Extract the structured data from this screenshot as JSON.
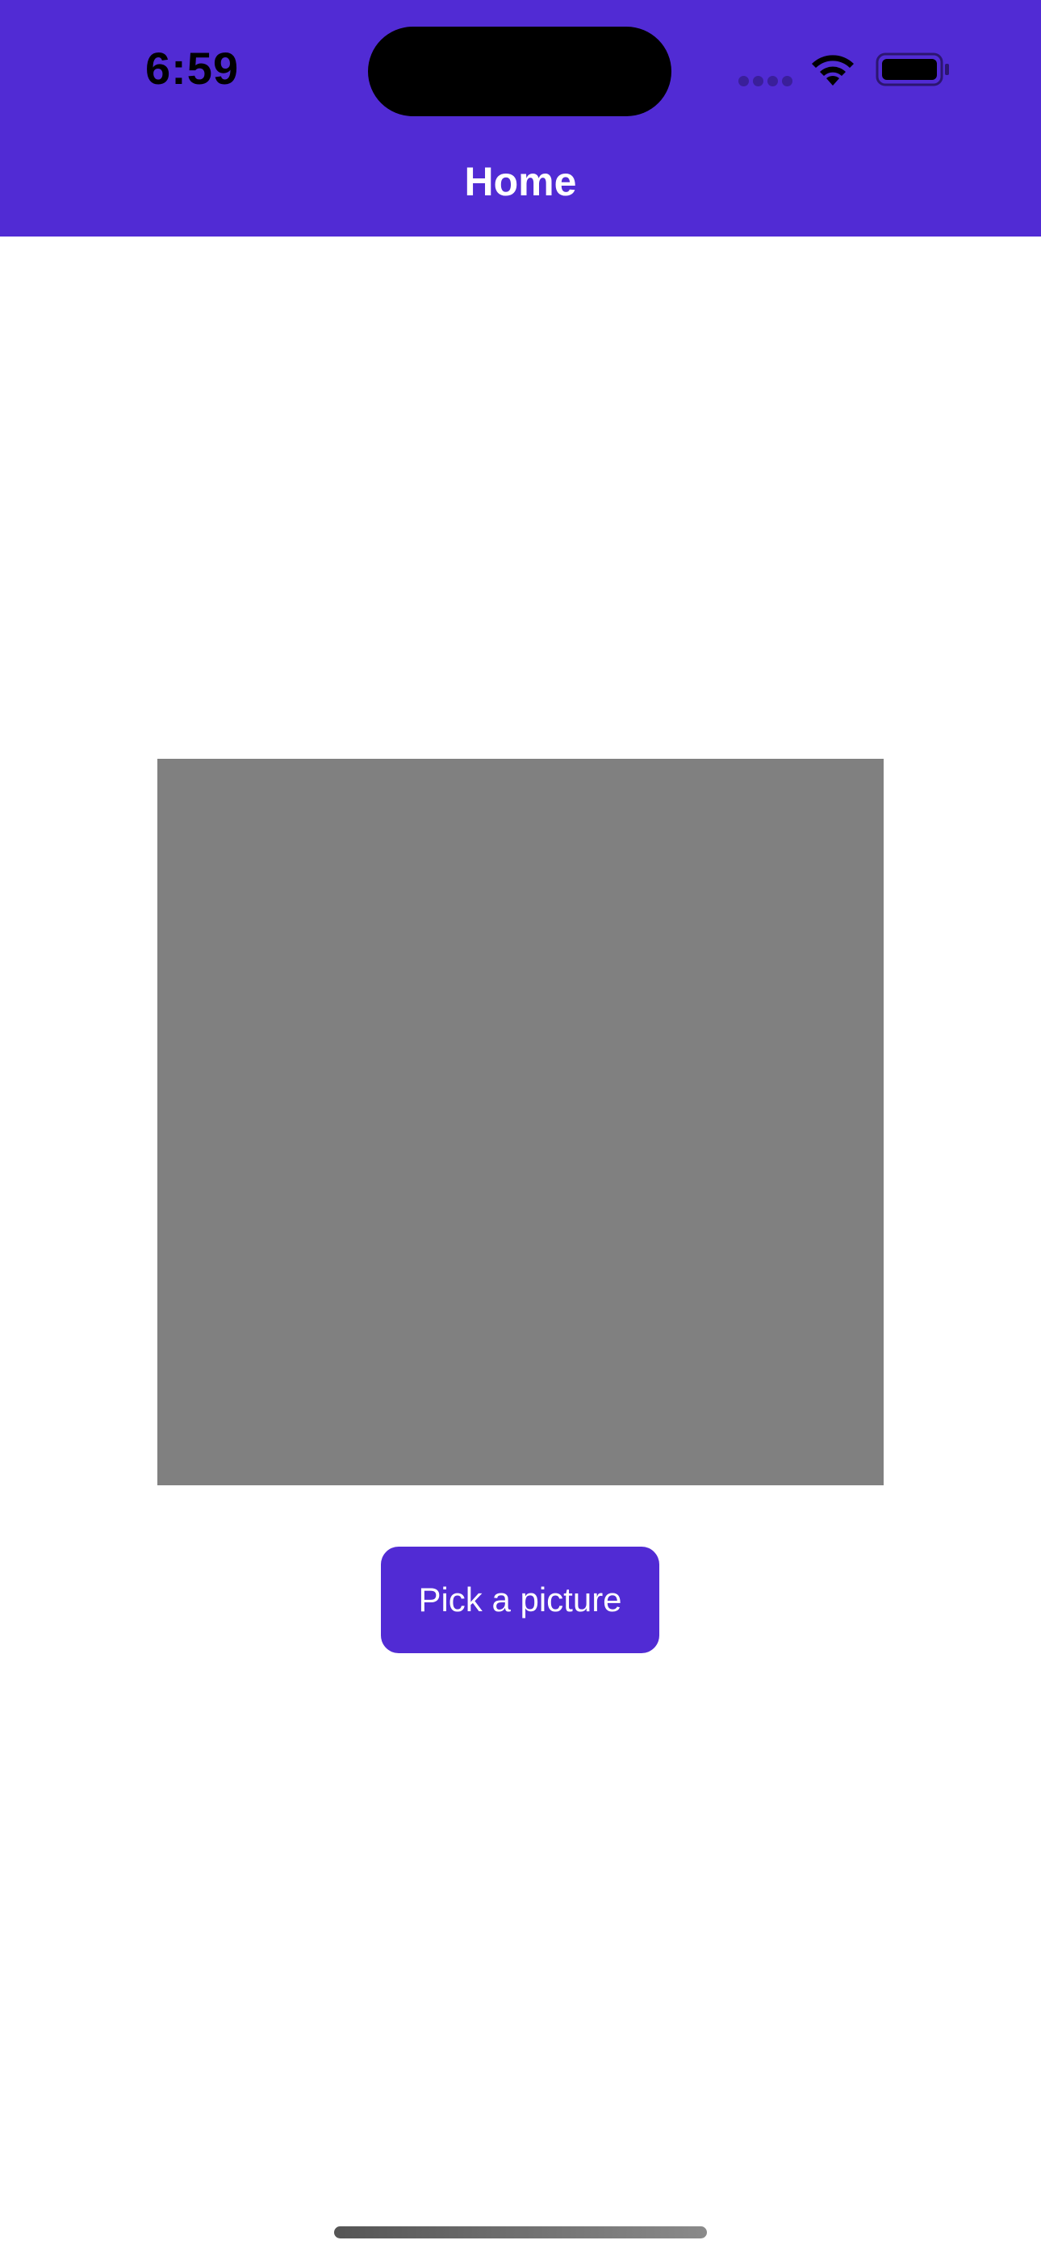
{
  "status_bar": {
    "time": "6:59",
    "icons": [
      "cellular-signal-icon",
      "wifi-icon",
      "battery-icon"
    ]
  },
  "header": {
    "title": "Home"
  },
  "main": {
    "image_placeholder_color": "#808080",
    "pick_button_label": "Pick a picture"
  },
  "colors": {
    "accent": "#512BD4",
    "background": "#FFFFFF",
    "placeholder": "#808080"
  }
}
